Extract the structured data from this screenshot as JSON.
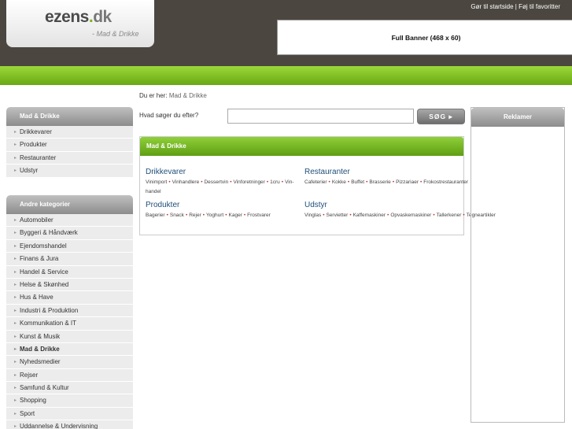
{
  "header": {
    "logo_name": "ezens",
    "logo_dot": ".",
    "logo_tld": "dk",
    "logo_sub": "- Mad & Drikke",
    "top_links": "Gør til startside | Føj til favoritter",
    "banner": "Full Banner (468 x 60)"
  },
  "breadcrumb": {
    "label": "Du er her:",
    "current": "Mad & Drikke"
  },
  "search": {
    "label": "Hvad søger du efter?",
    "value": "",
    "button": "SØG ▸"
  },
  "sidebar": {
    "section1": {
      "title": "Mad & Drikke",
      "items": [
        "Drikkevarer",
        "Produkter",
        "Restauranter",
        "Udstyr"
      ]
    },
    "section2": {
      "title": "Andre kategorier",
      "items": [
        "Automobiler",
        "Byggeri & Håndværk",
        "Ejendomshandel",
        "Finans & Jura",
        "Handel & Service",
        "Helse & Skønhed",
        "Hus & Have",
        "Industri & Produktion",
        "Kommunikation & IT",
        "Kunst & Musik",
        "Mad & Drikke",
        "Nyhedsmedier",
        "Rejser",
        "Samfund & Kultur",
        "Shopping",
        "Sport",
        "Uddannelse & Undervisning"
      ],
      "active": "Mad & Drikke"
    }
  },
  "main": {
    "title": "Mad & Drikke",
    "categories": [
      {
        "title": "Drikkevarer",
        "subs": [
          "Vinimport",
          "Vinhandlere",
          "Dessertvin",
          "Vinforetninger",
          "1cru",
          "Vin-handel"
        ]
      },
      {
        "title": "Restauranter",
        "subs": [
          "Cafeterier",
          "Kokke",
          "Buffet",
          "Brasserie",
          "Pizzariaer",
          "Frokostrestauranter"
        ]
      },
      {
        "title": "Produkter",
        "subs": [
          "Bagerier",
          "Snack",
          "Rejer",
          "Yoghurt",
          "Kager",
          "Frostvarer"
        ]
      },
      {
        "title": "Udstyr",
        "subs": [
          "Vinglas",
          "Servietter",
          "Kaffemaskiner",
          "Opvaskemaskiner",
          "Tallerkener",
          "Tegneartikler"
        ]
      }
    ]
  },
  "ads": {
    "title": "Reklamer"
  }
}
